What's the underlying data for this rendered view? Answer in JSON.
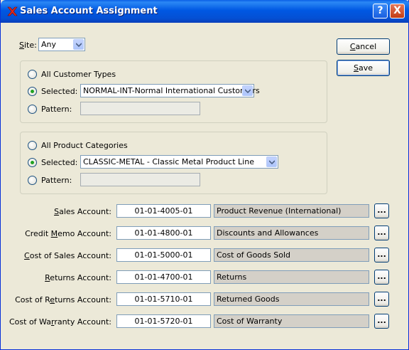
{
  "window": {
    "title": "Sales Account Assignment",
    "help_label": "?",
    "close_label": "X"
  },
  "site": {
    "label_pre": "",
    "label_u": "S",
    "label_post": "ite:",
    "value": "Any"
  },
  "buttons": {
    "cancel_u": "C",
    "cancel_rest": "ancel",
    "save_u": "S",
    "save_rest": "ave"
  },
  "customer_types": {
    "all_label": "All Customer Types",
    "selected_label": "Selected:",
    "selected_value": "NORMAL-INT-Normal International Customers",
    "pattern_label": "Pattern:",
    "pattern_value": "",
    "checked": "selected"
  },
  "product_categories": {
    "all_label": "All Product Categories",
    "selected_label": "Selected:",
    "selected_value": "CLASSIC-METAL - Classic Metal Product Line",
    "pattern_label": "Pattern:",
    "pattern_value": "",
    "checked": "selected"
  },
  "accounts": [
    {
      "pre": "",
      "u": "S",
      "post": "ales Account:",
      "number": "01-01-4005-01",
      "description": "Product Revenue (International)",
      "lookup": "..."
    },
    {
      "pre": "Credit ",
      "u": "M",
      "post": "emo Account:",
      "number": "01-01-4800-01",
      "description": "Discounts and Allowances",
      "lookup": "..."
    },
    {
      "pre": "",
      "u": "C",
      "post": "ost of Sales Account:",
      "number": "01-01-5000-01",
      "description": "Cost of Goods Sold",
      "lookup": "..."
    },
    {
      "pre": "",
      "u": "R",
      "post": "eturns Account:",
      "number": "01-01-4700-01",
      "description": "Returns",
      "lookup": "..."
    },
    {
      "pre": "Cost of R",
      "u": "e",
      "post": "turns Account:",
      "number": "01-01-5710-01",
      "description": "Returned Goods",
      "lookup": "..."
    },
    {
      "pre": "Cost of Wa",
      "u": "r",
      "post": "ranty Account:",
      "number": "01-01-5720-01",
      "description": "Cost of Warranty",
      "lookup": "..."
    }
  ],
  "colors": {
    "titlebar": "#0058e3",
    "window_bg": "#ece9d8",
    "radio_dot": "#21a121",
    "readonly_bg": "#d4d0c8"
  }
}
